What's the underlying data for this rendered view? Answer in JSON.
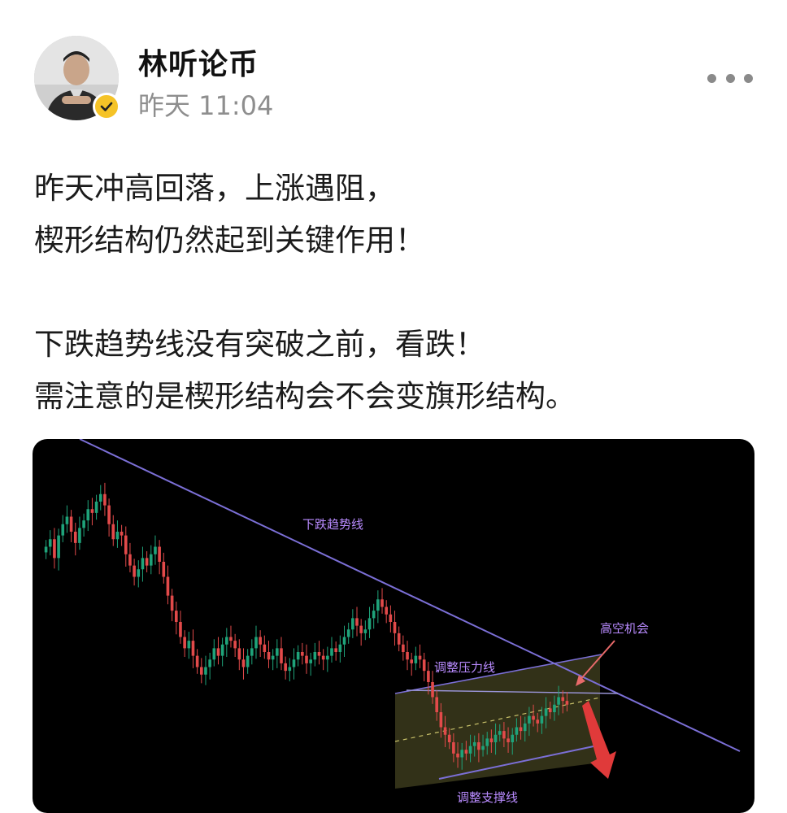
{
  "author": {
    "name": "林听论币",
    "time": "昨天 11:04",
    "avatar_icon": "avatar-person-icon",
    "verified_icon": "verified-badge-icon"
  },
  "menu": {
    "icon": "more-options-icon"
  },
  "post": {
    "lines": [
      "昨天冲高回落，上涨遇阻，",
      "楔形结构仍然起到关键作用！",
      "",
      "下跌趋势线没有突破之前，看跌！",
      "需注意的是楔形结构会不会变旗形结构。"
    ]
  },
  "chart_data": {
    "type": "candlestick",
    "annotations": {
      "downtrend_line": "下跌趋势线",
      "resistance_line": "调整压力线",
      "short_opportunity": "高空机会",
      "support_line": "调整支撑线"
    },
    "colors": {
      "up": "#1fa37a",
      "down": "#e24a4a",
      "trendline": "#7b6fd6",
      "label": "#b98bff",
      "zone_fill": "#5a5a2a",
      "arrow": "#e24a4a"
    },
    "closes": [
      60,
      62,
      57,
      63,
      66,
      68,
      64,
      61,
      65,
      67,
      70,
      69,
      72,
      74,
      71,
      66,
      62,
      64,
      63,
      58,
      55,
      52,
      54,
      57,
      55,
      58,
      60,
      56,
      52,
      47,
      43,
      40,
      36,
      33,
      35,
      31,
      28,
      26,
      28,
      30,
      33,
      31,
      34,
      36,
      35,
      33,
      30,
      28,
      31,
      33,
      36,
      34,
      32,
      30,
      31,
      33,
      29,
      27,
      28,
      30,
      32,
      31,
      29,
      30,
      32,
      31,
      30,
      31,
      33,
      32,
      34,
      36,
      38,
      41,
      39,
      37,
      38,
      41,
      43,
      46,
      44,
      42,
      40,
      37,
      34,
      32,
      30,
      29,
      31,
      30,
      27,
      24,
      20,
      16,
      12,
      10,
      8,
      5,
      4,
      6,
      5,
      7,
      8,
      6,
      7,
      9,
      8,
      10,
      11,
      9,
      8,
      10,
      12,
      11,
      13,
      15,
      14,
      13,
      15,
      17,
      16,
      18,
      20,
      19,
      18
    ]
  }
}
